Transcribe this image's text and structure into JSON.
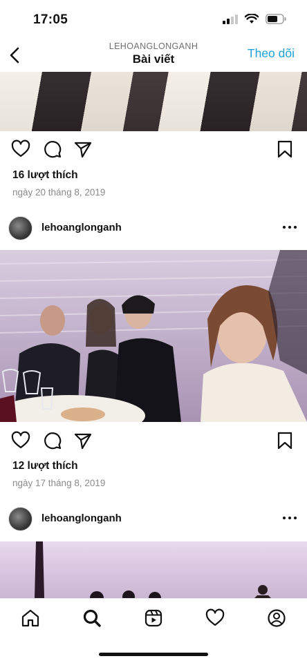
{
  "status_bar": {
    "time": "17:05"
  },
  "header": {
    "username": "LEHOANGLONGANH",
    "title": "Bài viết",
    "follow_label": "Theo dõi"
  },
  "posts": [
    {
      "likes": "16 lượt thích",
      "date": "ngày 20 tháng 8, 2019"
    },
    {
      "username": "lehoanglonganh",
      "likes": "12 lượt thích",
      "date": "ngày 17 tháng 8, 2019"
    },
    {
      "username": "lehoanglonganh"
    }
  ],
  "icons": {
    "back": "chevron-left-icon",
    "like": "heart-icon",
    "comment": "comment-icon",
    "share": "send-icon",
    "save": "bookmark-icon",
    "more": "more-icon",
    "nav": [
      "home-icon",
      "search-icon",
      "reels-icon",
      "activity-heart-icon",
      "profile-icon"
    ]
  },
  "colors": {
    "accent": "#1da1d6",
    "text": "#111111",
    "muted": "#8a8a8a"
  }
}
